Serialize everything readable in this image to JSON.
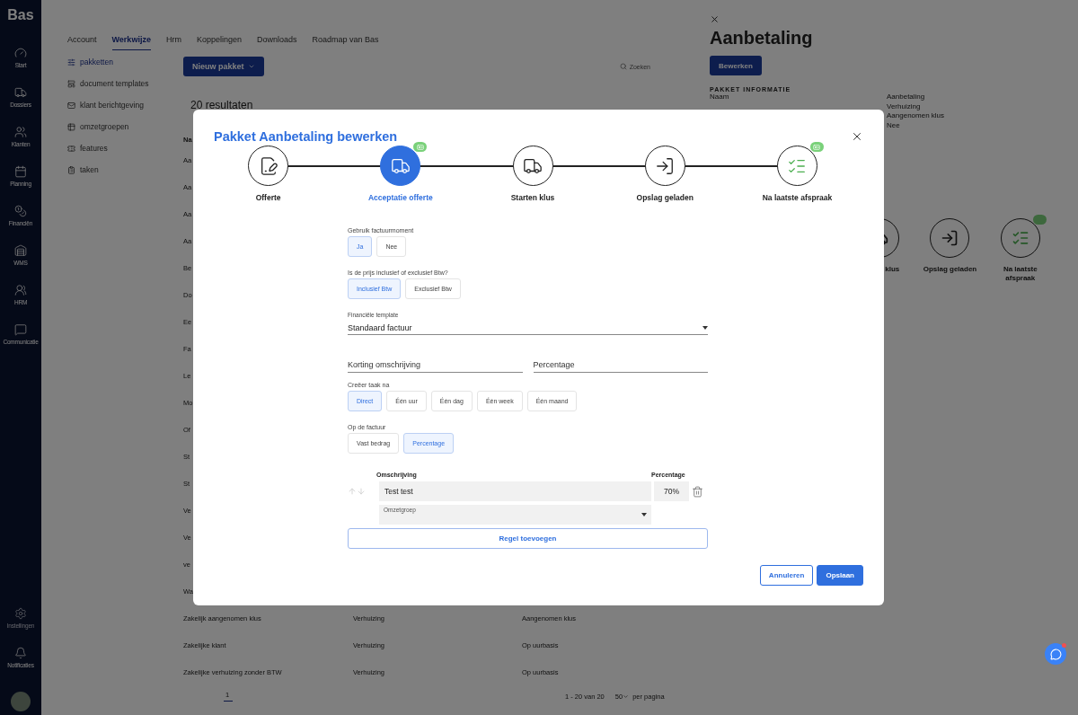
{
  "sidebar": {
    "logo": "Bas",
    "items": [
      {
        "label": "Start"
      },
      {
        "label": "Dossiers"
      },
      {
        "label": "Klanten"
      },
      {
        "label": "Planning"
      },
      {
        "label": "Financiën"
      },
      {
        "label": "WMS"
      },
      {
        "label": "HRM"
      },
      {
        "label": "Communicatie"
      }
    ],
    "bottom_items": [
      {
        "label": "Instellingen"
      },
      {
        "label": "Notificaties"
      }
    ]
  },
  "settings_tabs": [
    {
      "label": "Account",
      "selected": false
    },
    {
      "label": "Werkwijze",
      "selected": true
    },
    {
      "label": "Hrm",
      "selected": false
    },
    {
      "label": "Koppelingen",
      "selected": false
    },
    {
      "label": "Downloads",
      "selected": false
    },
    {
      "label": "Roadmap van Bas",
      "selected": false
    }
  ],
  "settings_menu": [
    {
      "label": "pakketten",
      "selected": true
    },
    {
      "label": "document templates",
      "selected": false
    },
    {
      "label": "klant berichtgeving",
      "selected": false
    },
    {
      "label": "omzetgroepen",
      "selected": false
    },
    {
      "label": "features",
      "selected": false
    },
    {
      "label": "taken",
      "selected": false
    }
  ],
  "toolbar": {
    "new_button": "Nieuw pakket",
    "search_placeholder": "Zoeken"
  },
  "results": "20 resultaten",
  "table": {
    "columns": [
      "Na"
    ],
    "rows": [
      [
        "Aa"
      ],
      [
        "Aa"
      ],
      [
        "Aa"
      ],
      [
        "Aa"
      ],
      [
        "Be"
      ],
      [
        "Do"
      ],
      [
        "Ee"
      ],
      [
        "Fa"
      ],
      [
        "Le"
      ],
      [
        "Mo"
      ],
      [
        "Of"
      ],
      [
        "St"
      ],
      [
        "St"
      ],
      [
        "Ve"
      ],
      [
        "Ve"
      ],
      [
        "ve"
      ],
      [
        "Wa"
      ],
      [
        "Zakelijk aangenomen klus",
        "Verhuizing",
        "Aangenomen klus"
      ],
      [
        "Zakelijke klant",
        "Verhuizing",
        "Op uurbasis"
      ],
      [
        "Zakelijke verhuizing zonder BTW",
        "Verhuizing",
        "Op uurbasis"
      ]
    ]
  },
  "pagination": {
    "pages": [
      {
        "label": "1",
        "selected": true
      }
    ],
    "range": "1 - 20 van 20",
    "page_size": "50",
    "per_page": "per pagina"
  },
  "drawer": {
    "title": "Aanbetaling",
    "edit_button": "Bewerken",
    "section": "PAKKET INFORMATIE",
    "field_label": "Naam",
    "values": [
      "Aanbetaling",
      "Verhuizing",
      "Aangenomen klus",
      "Nee"
    ],
    "steps": [
      {
        "label": "klus",
        "badge": false
      },
      {
        "label": "Opslag geladen",
        "badge": false
      },
      {
        "label": "Na laatste afspraak",
        "badge": true
      }
    ]
  },
  "modal": {
    "title": "Pakket Aanbetaling bewerken",
    "steps": [
      {
        "label": "Offerte",
        "selected": false,
        "badge": false
      },
      {
        "label": "Acceptatie offerte",
        "selected": true,
        "badge": true
      },
      {
        "label": "Starten klus",
        "selected": false,
        "badge": false
      },
      {
        "label": "Opslag geladen",
        "selected": false,
        "badge": false
      },
      {
        "label": "Na laatste afspraak",
        "selected": false,
        "badge": true
      }
    ],
    "groups": [
      {
        "label": "Gebruik factuurmoment",
        "options": [
          {
            "label": "Ja",
            "selected": true
          },
          {
            "label": "Nee",
            "selected": false
          }
        ]
      },
      {
        "label": "Is de prijs inclusief of exclusief Btw?",
        "options": [
          {
            "label": "Inclusief Btw",
            "selected": true
          },
          {
            "label": "Exclusief Btw",
            "selected": false
          }
        ]
      }
    ],
    "template": {
      "label": "Financiële template",
      "value": "Standaard factuur"
    },
    "discount": {
      "description_placeholder": "Korting omschrijving",
      "percentage_placeholder": "Percentage"
    },
    "groups2": [
      {
        "label": "Creëer taak na",
        "options": [
          {
            "label": "Direct",
            "selected": true
          },
          {
            "label": "Één uur",
            "selected": false
          },
          {
            "label": "Één dag",
            "selected": false
          },
          {
            "label": "Één week",
            "selected": false
          },
          {
            "label": "Één maand",
            "selected": false
          }
        ]
      },
      {
        "label": "Op de factuur",
        "options": [
          {
            "label": "Vast bedrag",
            "selected": false
          },
          {
            "label": "Percentage",
            "selected": true
          }
        ]
      }
    ],
    "lines": {
      "columns": [
        "Omschrijving",
        "Percentage"
      ],
      "rows": [
        {
          "description": "Test test",
          "percentage": "70%",
          "group_placeholder": "Omzetgroep"
        }
      ]
    },
    "add_button": "Regel toevoegen",
    "cancel_button": "Annuleren",
    "save_button": "Opslaan"
  }
}
